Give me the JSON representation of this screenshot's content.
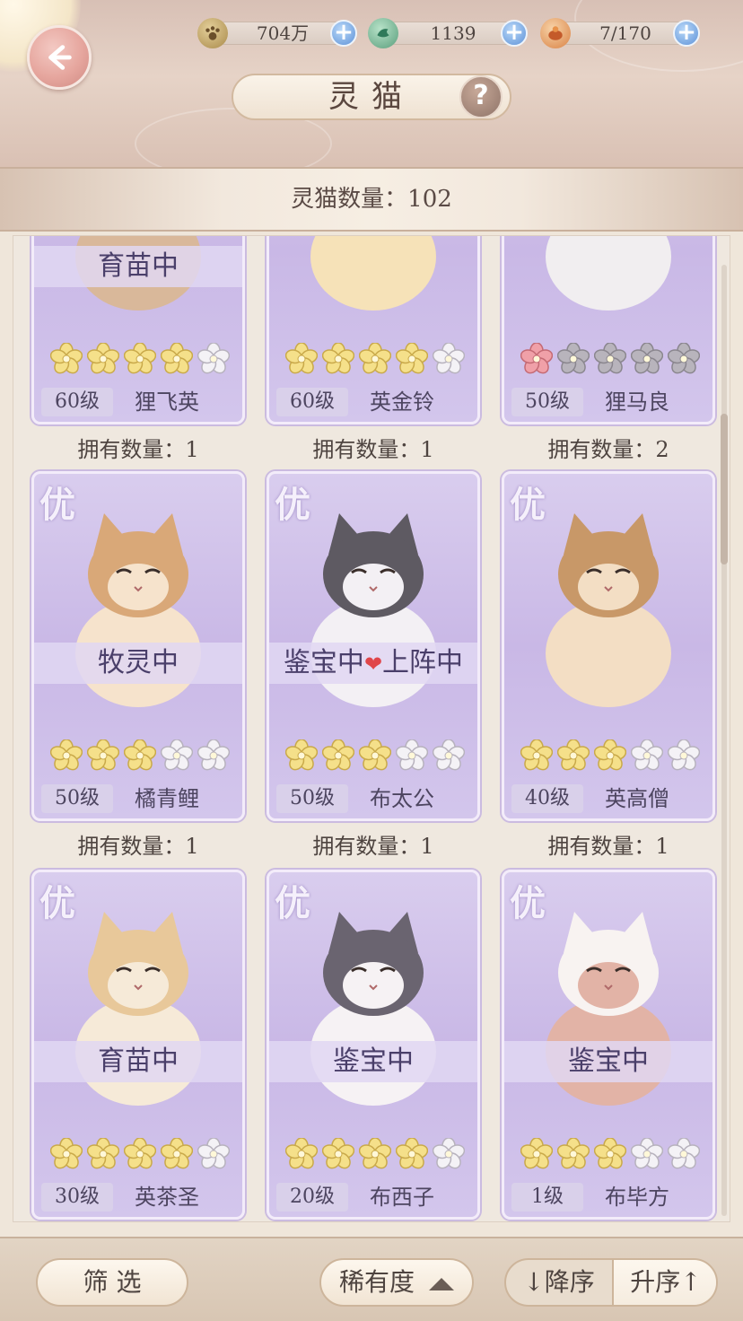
{
  "header": {
    "title": "灵猫",
    "help_label": "?",
    "resources": [
      {
        "icon": "paw-coin-icon",
        "value": "704万"
      },
      {
        "icon": "jade-bird-icon",
        "value": "1139"
      },
      {
        "icon": "fish-treat-icon",
        "value": "7/170"
      }
    ]
  },
  "summary": {
    "cat_count_label": "灵猫数量：102"
  },
  "cards": [
    {
      "grade": "",
      "status": "育苗中",
      "stars_filled": 4,
      "stars_total": 5,
      "star_color": "gold",
      "level": "60级",
      "name": "狸飞英",
      "owned": "拥有数量：1"
    },
    {
      "grade": "",
      "status": "",
      "stars_filled": 4,
      "stars_total": 5,
      "star_color": "gold",
      "level": "60级",
      "name": "英金铃",
      "owned": "拥有数量：1"
    },
    {
      "grade": "",
      "status": "",
      "stars_filled": 1,
      "stars_total": 5,
      "star_color": "pink",
      "level": "50级",
      "name": "狸马良",
      "owned": "拥有数量：2"
    },
    {
      "grade": "优",
      "status": "牧灵中",
      "stars_filled": 3,
      "stars_total": 5,
      "star_color": "gold",
      "level": "50级",
      "name": "橘青鲤",
      "owned": "拥有数量：1"
    },
    {
      "grade": "优",
      "status": "鉴宝中❤上阵中",
      "stars_filled": 3,
      "stars_total": 5,
      "star_color": "gold",
      "level": "50级",
      "name": "布太公",
      "owned": "拥有数量：1"
    },
    {
      "grade": "优",
      "status": "",
      "stars_filled": 3,
      "stars_total": 5,
      "star_color": "gold",
      "level": "40级",
      "name": "英高僧",
      "owned": "拥有数量：1"
    },
    {
      "grade": "优",
      "status": "育苗中",
      "stars_filled": 4,
      "stars_total": 5,
      "star_color": "gold",
      "level": "30级",
      "name": "英茶圣",
      "owned": ""
    },
    {
      "grade": "优",
      "status": "鉴宝中",
      "stars_filled": 4,
      "stars_total": 5,
      "star_color": "gold",
      "level": "20级",
      "name": "布西子",
      "owned": ""
    },
    {
      "grade": "优",
      "status": "鉴宝中",
      "stars_filled": 3,
      "stars_total": 5,
      "star_color": "gold",
      "level": "1级",
      "name": "布毕方",
      "owned": ""
    }
  ],
  "footer": {
    "filter_label": "筛 选",
    "rarity_label": "稀有度",
    "sort_desc_label": "↓降序",
    "sort_asc_label": "升序↑",
    "active_sort": "asc"
  },
  "colors": {
    "card_bg": "#c9b8e6",
    "star_gold": "#f5e08a",
    "star_white": "#f4f2f6",
    "star_pink": "#f0a0a8",
    "star_gray": "#b8b4bc"
  }
}
